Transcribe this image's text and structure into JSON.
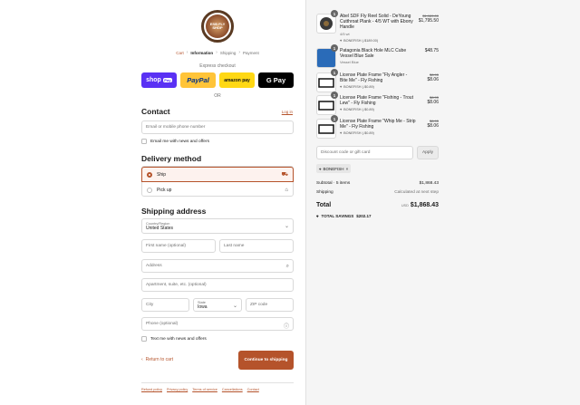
{
  "brand": {
    "logo_text": "ESB FLY SHOP"
  },
  "breadcrumb": {
    "cart": "Cart",
    "information": "Information",
    "shipping": "Shipping",
    "payment": "Payment",
    "sep": "›"
  },
  "express": {
    "label": "Express checkout",
    "shop_pay": "shop",
    "shop_pay_badge": "Pay",
    "paypal": "PayPal",
    "amazon": "amazon pay",
    "gpay": "G Pay",
    "or": "OR"
  },
  "contact": {
    "title": "Contact",
    "login": "Log in",
    "email_placeholder": "Email or mobile phone number",
    "news_label": "Email me with news and offers"
  },
  "delivery": {
    "title": "Delivery method",
    "ship": "Ship",
    "pickup": "Pick up"
  },
  "shipping": {
    "title": "Shipping address",
    "country_label": "Country/Region",
    "country_value": "United States",
    "first_name": "First name (optional)",
    "last_name": "Last name",
    "address": "Address",
    "apartment": "Apartment, suite, etc. (optional)",
    "city": "City",
    "state_label": "State",
    "state_value": "Iowa",
    "zip": "ZIP code",
    "phone": "Phone (optional)",
    "text_label": "Text me with news and offers"
  },
  "actions": {
    "return": "Return to cart",
    "continue": "Continue to shipping"
  },
  "footer": [
    "Refund policy",
    "Privacy policy",
    "Terms of service",
    "Cancellations",
    "Contact"
  ],
  "cart": {
    "items": [
      {
        "qty": "1",
        "name": "Abel SDF Fly Reel Solid - DeYoung Cutthroat Plank - 4/5 WT with Ebony Handle",
        "variant": "4/5 wt",
        "discount": "BONEFISH (-$189.00)",
        "orig": "$1,989.00",
        "price": "$1,795.50"
      },
      {
        "qty": "1",
        "name": "Patagonia Black Hole MLC Cube Vessel Blue Sale",
        "variant": "Vessel Blue",
        "discount": "",
        "orig": "",
        "price": "$48.75"
      },
      {
        "qty": "1",
        "name": "License Plate Frame \"Fly Angler - Bite Me\" - Fly Fishing",
        "variant": "",
        "discount": "BONEFISH (-$0.89)",
        "orig": "$8.95",
        "price": "$8.06"
      },
      {
        "qty": "1",
        "name": "License Plate Frame \"Fishing - Trout Lew\" - Fly Fishing",
        "variant": "",
        "discount": "BONEFISH (-$0.89)",
        "orig": "$8.95",
        "price": "$8.06"
      },
      {
        "qty": "1",
        "name": "License Plate Frame \"Whip Me - Strip Me\" - Fly Fishing",
        "variant": "",
        "discount": "BONEFISH (-$0.89)",
        "orig": "$8.95",
        "price": "$8.06"
      }
    ],
    "discount_placeholder": "Discount code or gift card",
    "apply": "Apply",
    "applied_code": "BONEFISH",
    "subtotal_label": "Subtotal · 5 items",
    "subtotal_value": "$1,868.43",
    "shipping_label": "Shipping",
    "shipping_value": "Calculated at next step",
    "total_label": "Total",
    "currency": "USD",
    "total_value": "$1,868.43",
    "savings_label": "TOTAL SAVINGS",
    "savings_value": "$202.17"
  },
  "colors": {
    "accent": "#b5532b",
    "shop_pay": "#5a31f4",
    "paypal": "#ffc439",
    "amazon": "#ffd814",
    "gpay": "#000000"
  }
}
